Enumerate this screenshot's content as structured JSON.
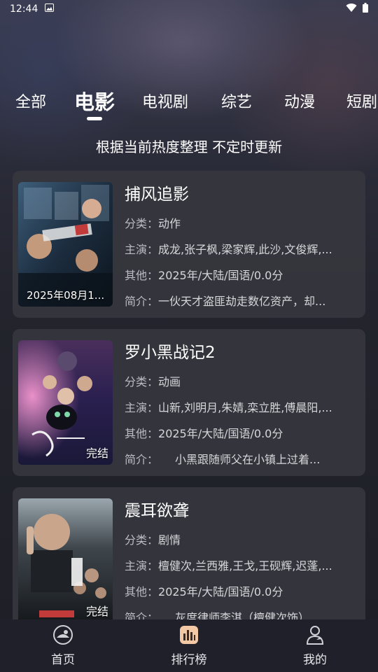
{
  "status_bar": {
    "time": "12:44"
  },
  "tabs": [
    "全部",
    "电影",
    "电视剧",
    "综艺",
    "动漫",
    "短剧"
  ],
  "active_tab": "电影",
  "subtitle": "根据当前热度整理 不定时更新",
  "cards": [
    {
      "title": "捕风追影",
      "category_key": "分类：",
      "category": "动作",
      "cast_key": "主演：",
      "cast": "成龙,张子枫,梁家辉,此沙,文俊辉,...",
      "other_key": "其他：",
      "other": "2025年/大陆/国语/0.0分",
      "intro_key": "简介：",
      "intro": "一伙天才盗匪劫走数亿资产，却...",
      "badge": "2025年08月1..."
    },
    {
      "title": "罗小黑战记2",
      "category_key": "分类：",
      "category": "动画",
      "cast_key": "主演：",
      "cast": "山新,刘明月,朱婧,栾立胜,傅晨阳,...",
      "other_key": "其他：",
      "other": "2025年/大陆/国语/0.0分",
      "intro_key": "简介：",
      "intro": "　　小黑跟随师父在小镇上过着...",
      "badge": "完结"
    },
    {
      "title": "震耳欲聋",
      "category_key": "分类：",
      "category": "剧情",
      "cast_key": "主演：",
      "cast": "檀健次,兰西雅,王戈,王砚辉,迟蓬,...",
      "other_key": "其他：",
      "other": "2025年/大陆/国语/0.0分",
      "intro_key": "简介：",
      "intro": "　　灰度律师李淇（檀健次饰）...",
      "badge": "完结"
    }
  ],
  "nav": {
    "home": "首页",
    "ranking": "排行榜",
    "mine": "我的"
  },
  "colors": {
    "card_bg": "#36363e",
    "nav_bg": "#1f2029",
    "accent": "#ffffff"
  }
}
